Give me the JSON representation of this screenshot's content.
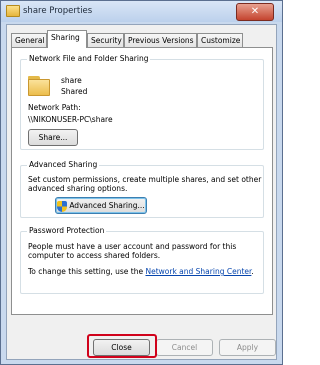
{
  "window": {
    "title": "share Properties",
    "close_glyph": "✕"
  },
  "tabs": [
    {
      "label": "General"
    },
    {
      "label": "Sharing"
    },
    {
      "label": "Security"
    },
    {
      "label": "Previous Versions"
    },
    {
      "label": "Customize"
    }
  ],
  "network_sharing": {
    "title": "Network File and Folder Sharing",
    "folder_name": "share",
    "folder_status": "Shared",
    "network_path_label": "Network Path:",
    "network_path_value": "\\\\NIKONUSER-PC\\share",
    "share_button": "Share..."
  },
  "advanced_sharing": {
    "title": "Advanced Sharing",
    "description_line1": "Set custom permissions, create multiple shares, and set other",
    "description_line2": "advanced sharing options.",
    "button": "Advanced Sharing..."
  },
  "password_protection": {
    "title": "Password Protection",
    "line1": "People must have a user account and password for this",
    "line2": "computer to access shared folders.",
    "change_text": "To change this setting, use the ",
    "link": "Network and Sharing Center",
    "link_suffix": "."
  },
  "footer": {
    "close": "Close",
    "cancel": "Cancel",
    "apply": "Apply"
  }
}
